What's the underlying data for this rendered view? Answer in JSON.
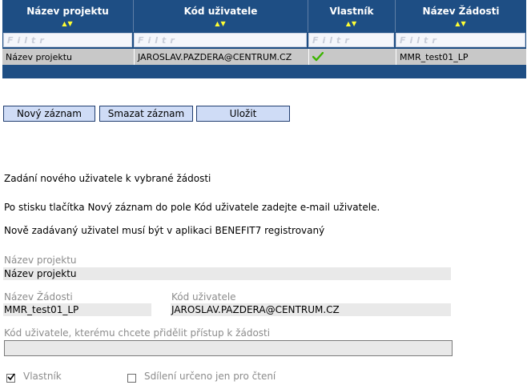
{
  "grid": {
    "columns": [
      {
        "label": "Název projektu",
        "filter": "Filtr"
      },
      {
        "label": "Kód uživatele",
        "filter": "Filtr"
      },
      {
        "label": "Vlastník",
        "filter": "Filtr"
      },
      {
        "label": "Název Žádosti",
        "filter": "Filtr"
      }
    ],
    "rows": [
      {
        "nazev_projektu": "Název projektu",
        "kod_uzivatele": "JAROSLAV.PAZDERA@CENTRUM.CZ",
        "vlastnik": true,
        "nazev_zadosti": "MMR_test01_LP"
      }
    ]
  },
  "toolbar": {
    "new_label": "Nový záznam",
    "delete_label": "Smazat záznam",
    "save_label": "Uložit"
  },
  "info": {
    "heading": "Zadání nového uživatele k vybrané žádosti",
    "line1": "Po stisku tlačítka Nový záznam do pole Kód uživatele zadejte e-mail uživatele.",
    "line2": "Nově zadávaný uživatel musí být v aplikaci BENEFIT7 registrovaný"
  },
  "form": {
    "nazev_projektu": {
      "label": "Název projektu",
      "value": "Název projektu"
    },
    "nazev_zadosti": {
      "label": "Název Žádosti",
      "value": "MMR_test01_LP"
    },
    "kod_uzivatele": {
      "label": "Kód uživatele",
      "value": "JAROSLAV.PAZDERA@CENTRUM.CZ"
    },
    "pristup": {
      "label": "Kód uživatele, kterému chcete přidělit přístup k žádosti",
      "value": ""
    },
    "vlastnik": {
      "label": "Vlastník",
      "checked": true
    },
    "sdileni": {
      "label": "Sdílení určeno jen pro čtení",
      "checked": false
    }
  },
  "colors": {
    "grid_header": "#1e4e84",
    "sort_arrows": "#ffff33",
    "check": "#3cb400"
  }
}
